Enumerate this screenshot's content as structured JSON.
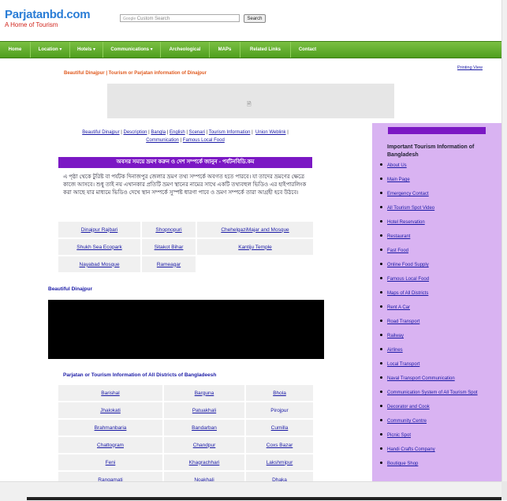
{
  "header": {
    "logo_title": "Parjatanbd.com",
    "logo_subtitle": "A Home of Tourism",
    "search_placeholder": "Custom Search",
    "search_brand": "Google",
    "search_button": "Search"
  },
  "nav": [
    "Home",
    "Location",
    "Hotels",
    "Communications",
    "Archeological",
    "MAPs",
    "Related Links",
    "Contact"
  ],
  "printing_view": "Printing View",
  "page_heading": "Beautiful Dinajpur | Tourism or Parjatan information of Dinajpur",
  "ad_icon": "🗎",
  "quick_links": [
    "Beautiful Dinajpur",
    "Description",
    "Bangla",
    "English",
    "Scenari",
    "Tourism Information",
    "Union Weblink",
    "Communication",
    "Famous Local Food"
  ],
  "bangla_banner": "অবসর সময়ে ভ্রমণ করুন ও দেশ সম্পর্কে জানুন - পর্যটনবিডি.কম",
  "bangla_description": "এ পৃষ্ঠা থেকে টুরিষ্ট বা পর্যটক দিনাজপুর জেলার ভ্রমণ তথ্য সম্পর্কে অবগত হতে পারবে। যা তাদের ভ্রমণের ক্ষেত্রে কাজে আসবে। শুধু তাই নয় এখানকার প্রতিটি ভ্রমণ স্থানের নামের সাথে একটি তথ্যবহুল ভিডিও এর হাইপারলিংক করা আছে যার মাধ্যমে ভিডিও দেখে স্থান সম্পর্কে সুস্পষ্ট ধারণা পাবে ও ভ্রমণ সম্পর্কে তারা আগ্রহী হবে উঠবে।",
  "spots": [
    [
      "Dinajpur Rajbari",
      "Shopnopuri",
      "ChehelgaziMajar and Mosque"
    ],
    [
      "Shukh Sea Ecopark",
      "Sitakot Bihar",
      "Kantiju Temple"
    ],
    [
      "Nayabad Mosque",
      "Rameagar",
      ""
    ]
  ],
  "video_label": "Beautiful Dinajpur",
  "districts_heading": "Parjatan or Tourism Information of All Districts of Bangladeesh",
  "districts": [
    [
      "Barishal",
      "Barguna",
      "Bhola"
    ],
    [
      "Jhalokati",
      "Patuakhali",
      "Pirojpur"
    ],
    [
      "Brahmanbaria",
      "Bandarban",
      "Cumilla"
    ],
    [
      "Chattogram",
      "Chandpur",
      "Coxs Bazar"
    ],
    [
      "Feni",
      "Khagrachhari",
      "Lakshmipur"
    ],
    [
      "Rangamati",
      "Noakhali",
      "Dhaka"
    ]
  ],
  "sidebar": {
    "title": "Important Tourism Information of Bangladesh",
    "items": [
      "About Us",
      "Main Page",
      "Emergency Contact",
      "All Tourism Spot Video",
      "Hotel Reservation",
      "Restaurant",
      "Fast Food",
      "Online Food Supply",
      "Famous Local Food",
      "Maps of All Districts",
      "Rent A Car",
      "Road Transport",
      "Railway",
      "Airlines",
      "Local Transport",
      "Naval Transport Communication",
      "Communication System of All Tourism Spot",
      "Decorator and Cook",
      "Community Centre",
      "Picnic Spot",
      "Handi Crafts Company",
      "Boutique Shop"
    ]
  },
  "colors": {
    "nav_green": "#5aa82a",
    "banner_purple": "#7b18c4",
    "sidebar_lavender": "#d9b3f2",
    "link_blue": "#1a1aa6",
    "heading_orange": "#e05a1e"
  }
}
